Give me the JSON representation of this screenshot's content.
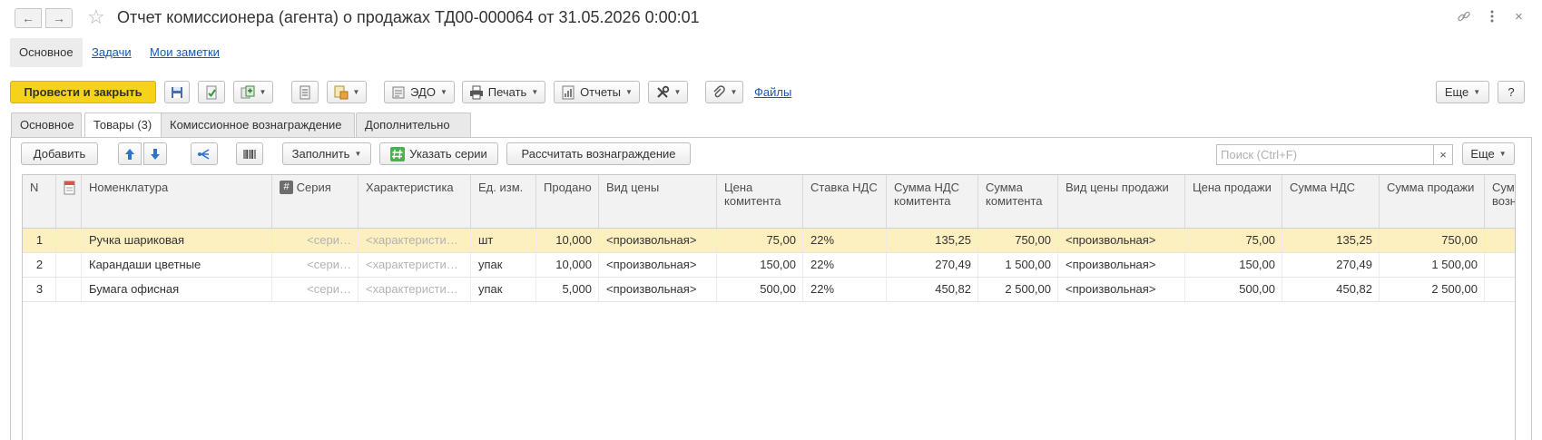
{
  "window": {
    "title": "Отчет комиссионера (агента) о продажах ТД00-000064 от 31.05.2026 0:00:01",
    "back_icon": "arrow-left-icon",
    "forward_icon": "arrow-right-icon",
    "favorite_icon": "star-icon",
    "link_icon": "link-icon",
    "menu_icon": "more-vertical-icon",
    "close_icon": "close-icon"
  },
  "nav_tabs": [
    {
      "label": "Основное"
    },
    {
      "label": "Задачи"
    },
    {
      "label": "Мои заметки"
    }
  ],
  "toolbar": {
    "post_close_label": "Провести и закрыть",
    "edo_label": "ЭДО",
    "print_label": "Печать",
    "reports_label": "Отчеты",
    "files_label": "Файлы",
    "more_label": "Еще",
    "help_label": "?"
  },
  "doc_tabs": [
    {
      "label": "Основное"
    },
    {
      "label": "Товары (3)"
    },
    {
      "label": "Комиссионное вознаграждение"
    },
    {
      "label": "Дополнительно"
    }
  ],
  "subtoolbar": {
    "add_label": "Добавить",
    "fill_label": "Заполнить",
    "series_label": "Указать серии",
    "calc_label": "Рассчитать вознаграждение",
    "search_placeholder": "Поиск (Ctrl+F)",
    "search_clear": "×",
    "more_label": "Еще"
  },
  "table": {
    "headers": {
      "n": "N",
      "nomenclature": "Номенклатура",
      "series": "Серия",
      "characteristic": "Характеристика",
      "unit": "Ед. изм.",
      "sold": "Продано",
      "price_type": "Вид цены",
      "principal_price": "Цена комитента",
      "vat_rate": "Ставка НДС",
      "principal_vat": "Сумма НДС комитента",
      "principal_sum": "Сумма комитента",
      "sale_price_type": "Вид цены продажи",
      "sale_price": "Цена продажи",
      "vat_sum": "Сумма НДС",
      "sale_sum": "Сумма продажи",
      "reward_sum": "Сумма вознагра"
    },
    "rows": [
      {
        "n": "1",
        "nomenclature": "Ручка шариковая",
        "series": "<сери…",
        "characteristic": "<характеристи…",
        "unit": "шт",
        "sold": "10,000",
        "price_type": "<произвольная>",
        "principal_price": "75,00",
        "vat_rate": "22%",
        "principal_vat": "135,25",
        "principal_sum": "750,00",
        "sale_price_type": "<произвольная>",
        "sale_price": "75,00",
        "vat_sum": "135,25",
        "sale_sum": "750,00"
      },
      {
        "n": "2",
        "nomenclature": "Карандаши цветные",
        "series": "<сери…",
        "characteristic": "<характеристи…",
        "unit": "упак",
        "sold": "10,000",
        "price_type": "<произвольная>",
        "principal_price": "150,00",
        "vat_rate": "22%",
        "principal_vat": "270,49",
        "principal_sum": "1 500,00",
        "sale_price_type": "<произвольная>",
        "sale_price": "150,00",
        "vat_sum": "270,49",
        "sale_sum": "1 500,00"
      },
      {
        "n": "3",
        "nomenclature": "Бумага офисная",
        "series": "<сери…",
        "characteristic": "<характеристи…",
        "unit": "упак",
        "sold": "5,000",
        "price_type": "<произвольная>",
        "principal_price": "500,00",
        "vat_rate": "22%",
        "principal_vat": "450,82",
        "principal_sum": "2 500,00",
        "sale_price_type": "<произвольная>",
        "sale_price": "500,00",
        "vat_sum": "450,82",
        "sale_sum": "2 500,00"
      }
    ]
  },
  "colors": {
    "primary_button": "#f6d21b",
    "selected_row": "#fcefc0",
    "link": "#1a55b8"
  }
}
